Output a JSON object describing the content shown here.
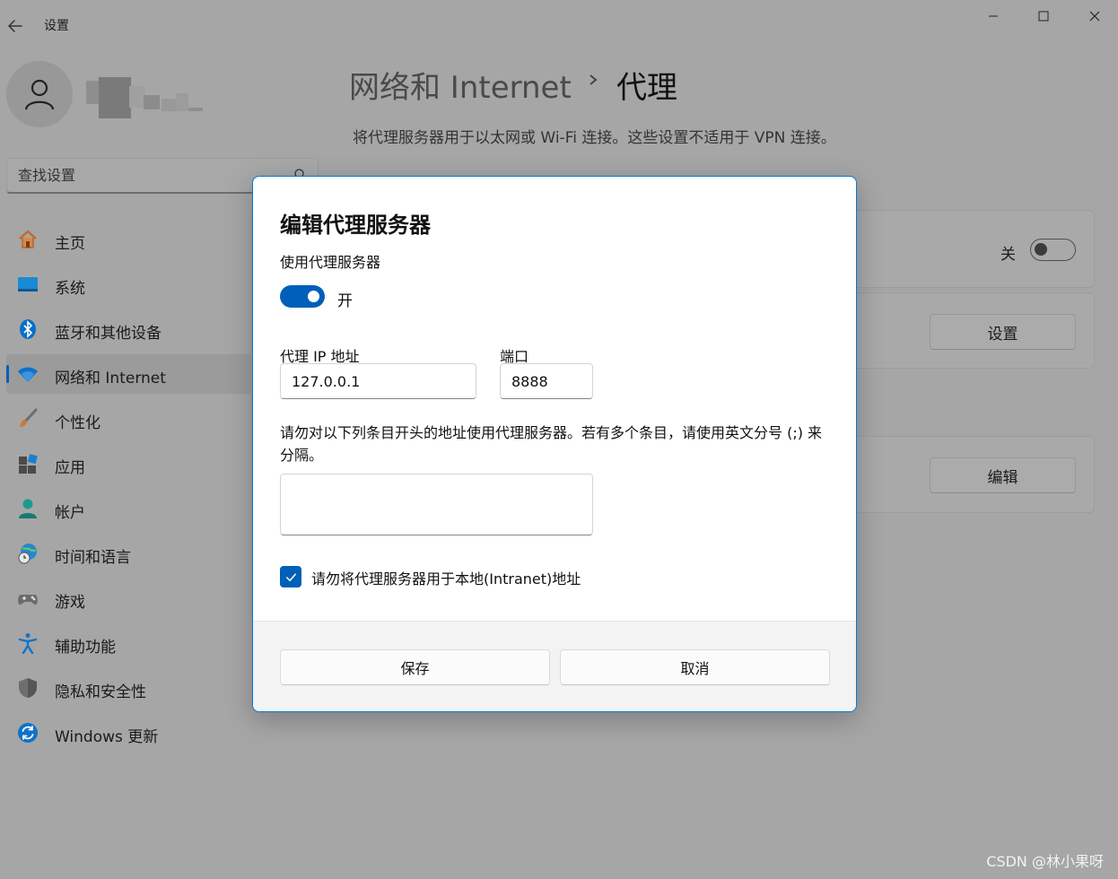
{
  "window": {
    "title": "设置",
    "back_icon": "arrow-left-icon",
    "controls": [
      "minimize-icon",
      "maximize-icon",
      "close-icon"
    ]
  },
  "profile": {
    "avatar_icon": "user-icon",
    "name": "(blurred)"
  },
  "search": {
    "placeholder": "查找设置",
    "icon": "search-icon"
  },
  "sidebar": {
    "items": [
      {
        "label": "主页",
        "icon": "home-icon"
      },
      {
        "label": "系统",
        "icon": "monitor-icon"
      },
      {
        "label": "蓝牙和其他设备",
        "icon": "bluetooth-icon"
      },
      {
        "label": "网络和 Internet",
        "icon": "wifi-icon",
        "active": true
      },
      {
        "label": "个性化",
        "icon": "brush-icon"
      },
      {
        "label": "应用",
        "icon": "apps-icon"
      },
      {
        "label": "帐户",
        "icon": "account-icon"
      },
      {
        "label": "时间和语言",
        "icon": "globe-clock-icon"
      },
      {
        "label": "游戏",
        "icon": "gamepad-icon"
      },
      {
        "label": "辅助功能",
        "icon": "accessibility-icon"
      },
      {
        "label": "隐私和安全性",
        "icon": "shield-icon"
      },
      {
        "label": "Windows 更新",
        "icon": "update-icon"
      }
    ]
  },
  "header": {
    "breadcrumb_parent": "网络和 Internet",
    "breadcrumb_current": "代理",
    "description": "将代理服务器用于以太网或 Wi-Fi 连接。这些设置不适用于 VPN 连接。"
  },
  "background_cards": {
    "auto_detect_toggle_label": "关",
    "auto_detect_toggle_on": false,
    "setup_button": "设置",
    "edit_button": "编辑"
  },
  "dialog": {
    "title": "编辑代理服务器",
    "use_proxy_label": "使用代理服务器",
    "use_proxy_on": true,
    "use_proxy_state": "开",
    "ip_label": "代理 IP 地址",
    "ip_value": "127.0.0.1",
    "port_label": "端口",
    "port_value": "8888",
    "exceptions_help": "请勿对以下列条目开头的地址使用代理服务器。若有多个条目，请使用英文分号 (;) 来分隔。",
    "exceptions_value": "",
    "bypass_local_checked": true,
    "bypass_local_label": "请勿将代理服务器用于本地(Intranet)地址",
    "save_button": "保存",
    "cancel_button": "取消"
  },
  "watermark": "CSDN @林小果呀",
  "colors": {
    "accent": "#005fb8",
    "overlay_bg": "#a6a6a6",
    "dialog_border": "#0078d4"
  }
}
